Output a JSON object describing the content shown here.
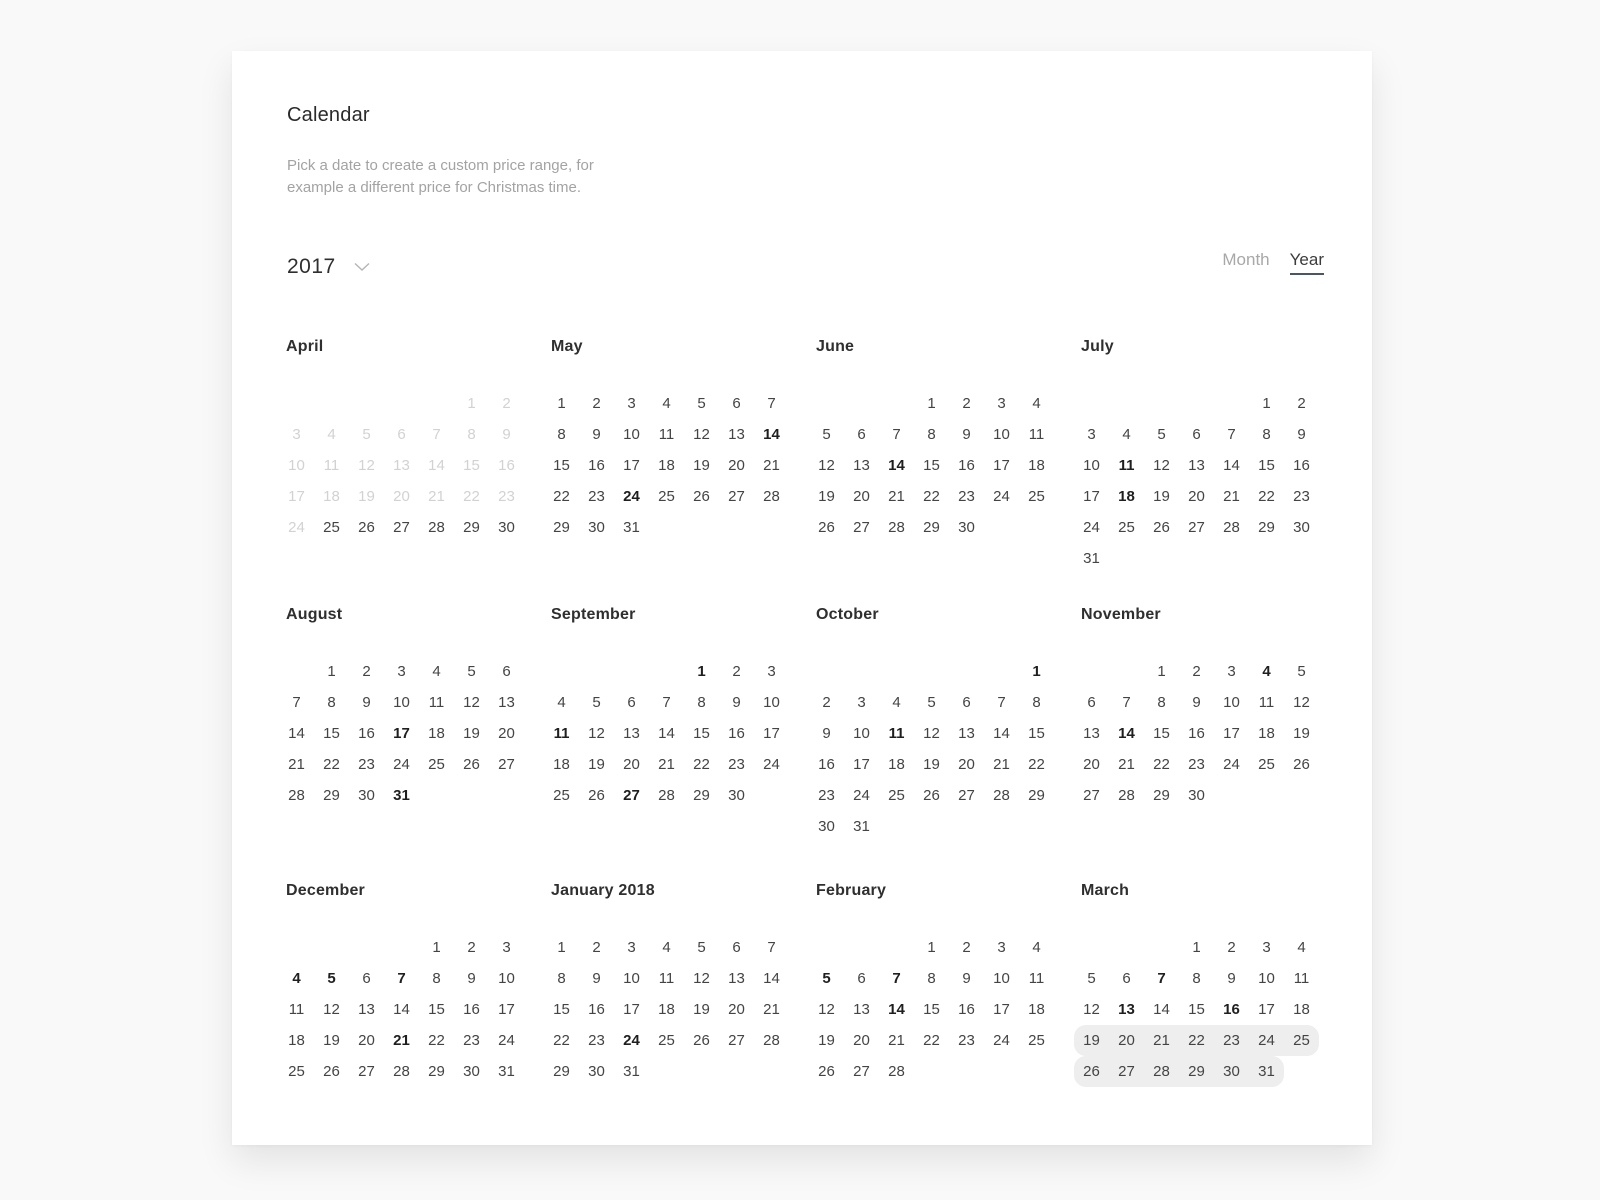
{
  "header": {
    "title": "Calendar",
    "subtitle": "Pick a date to create a custom price range, for example a different price for Christmas time."
  },
  "year_selector": {
    "value": "2017",
    "icon": "chevron-down-icon"
  },
  "view_toggle": {
    "month_label": "Month",
    "year_label": "Year",
    "active": "year"
  },
  "colors": {
    "accent_underline": "#4b5568",
    "dimmed_text": "#d2d2d2",
    "range_highlight": "#eeeeee",
    "background": "#f9f9f9"
  },
  "months": [
    {
      "name": "April",
      "offset": 5,
      "days": 30,
      "dimmed_before": 25,
      "bold": [],
      "range": []
    },
    {
      "name": "May",
      "offset": 0,
      "days": 31,
      "dimmed_before": 0,
      "bold": [
        14,
        24
      ],
      "range": []
    },
    {
      "name": "June",
      "offset": 3,
      "days": 30,
      "dimmed_before": 0,
      "bold": [
        14
      ],
      "range": []
    },
    {
      "name": "July",
      "offset": 5,
      "days": 31,
      "dimmed_before": 0,
      "bold": [
        11,
        18
      ],
      "range": []
    },
    {
      "name": "August",
      "offset": 1,
      "days": 31,
      "dimmed_before": 0,
      "bold": [
        17,
        31
      ],
      "range": []
    },
    {
      "name": "September",
      "offset": 4,
      "days": 30,
      "dimmed_before": 0,
      "bold": [
        1,
        11,
        27
      ],
      "range": []
    },
    {
      "name": "October",
      "offset": 6,
      "days": 31,
      "dimmed_before": 0,
      "bold": [
        1,
        11
      ],
      "range": []
    },
    {
      "name": "November",
      "offset": 2,
      "days": 30,
      "dimmed_before": 0,
      "bold": [
        4,
        14
      ],
      "range": []
    },
    {
      "name": "December",
      "offset": 4,
      "days": 31,
      "dimmed_before": 0,
      "bold": [
        4,
        5,
        7,
        21
      ],
      "range": []
    },
    {
      "name": "January 2018",
      "offset": 0,
      "days": 31,
      "dimmed_before": 0,
      "bold": [
        24
      ],
      "range": []
    },
    {
      "name": "February",
      "offset": 3,
      "days": 28,
      "dimmed_before": 0,
      "bold": [
        5,
        7,
        14
      ],
      "range": []
    },
    {
      "name": "March",
      "offset": 3,
      "days": 31,
      "dimmed_before": 0,
      "bold": [
        7,
        13,
        16
      ],
      "range": [
        19,
        31
      ]
    }
  ]
}
